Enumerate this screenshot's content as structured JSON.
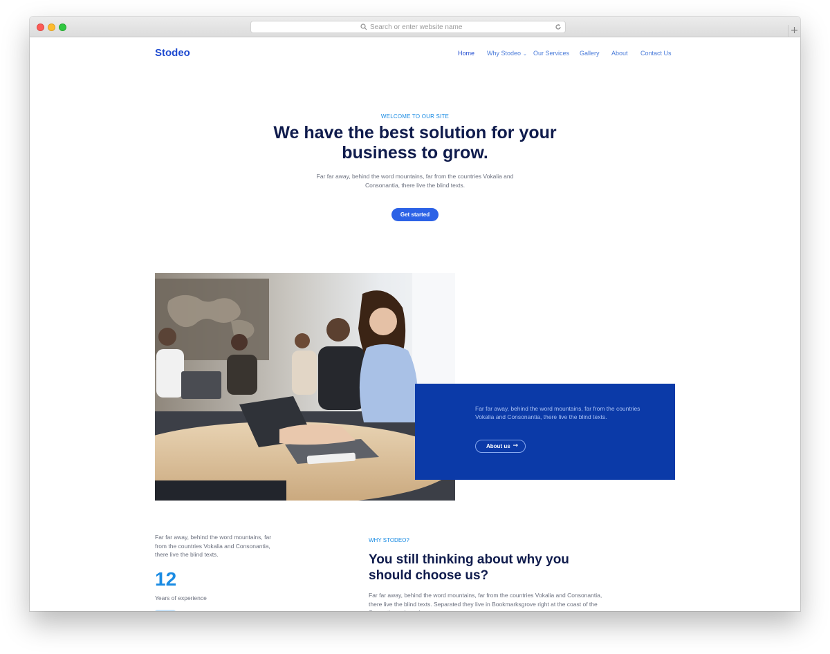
{
  "browser": {
    "address_placeholder": "Search or enter website name",
    "new_tab_label": "+"
  },
  "site": {
    "logo": "Stodeo",
    "nav": {
      "home": "Home",
      "why": "Why Stodeo",
      "services": "Our Services",
      "gallery": "Gallery",
      "about": "About",
      "contact": "Contact Us"
    }
  },
  "hero": {
    "eyebrow": "WELCOME TO OUR SITE",
    "title": "We have the best solution for your business to grow.",
    "text": "Far far away, behind the word mountains, far from the countries Vokalia and Consonantia, there live the blind texts.",
    "cta": "Get started"
  },
  "about_block": {
    "text": "Far far away, behind the word mountains, far from the countries Vokalia and Consonantia, there live the blind texts.",
    "button": "About us",
    "button_icon": "arrow-right-icon"
  },
  "stats": {
    "text": "Far far away, behind the word mountains, far from the countries Vokalia and Consonantia, there live the blind texts.",
    "number": "12",
    "label": "Years of experience"
  },
  "why": {
    "eyebrow": "WHY STODEO?",
    "title": "You still thinking about why you should choose us?",
    "text": "Far far away, behind the word mountains, far from the countries Vokalia and Consonantia, there live the blind texts. Separated they live in Bookmarksgrove right at the coast of the Semantics, a large language ocean."
  },
  "colors": {
    "brand_blue": "#1f4bd0",
    "button_blue": "#2c62e6",
    "panel_blue": "#0b3aa8",
    "accent_light_blue": "#1a8be3",
    "heading_navy": "#0f1b4c"
  }
}
